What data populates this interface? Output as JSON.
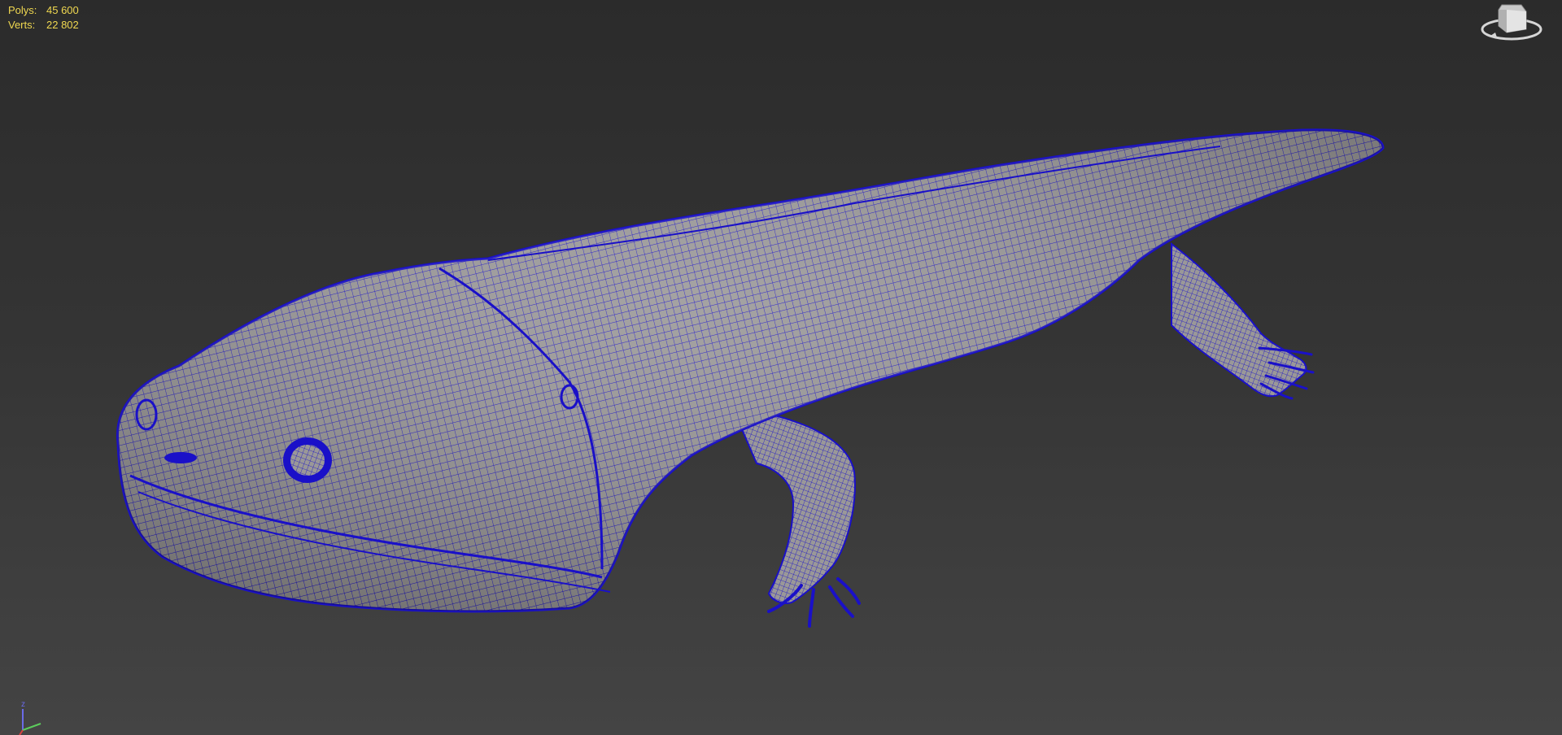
{
  "viewport": {
    "stats": {
      "polys_label": "Polys:",
      "polys_value": "45 600",
      "verts_label": "Verts:",
      "verts_value": "22 802"
    },
    "axis": {
      "z_label": "z"
    },
    "colors": {
      "background_top": "#2b2b2b",
      "background_bottom": "#444444",
      "mesh_surface": "#9a9898",
      "wireframe": "#1a10c8",
      "stats_text": "#f0d850"
    },
    "model": "salamander-wireframe-mesh",
    "icons": [
      "viewcube-icon",
      "axis-tripod-icon"
    ]
  }
}
